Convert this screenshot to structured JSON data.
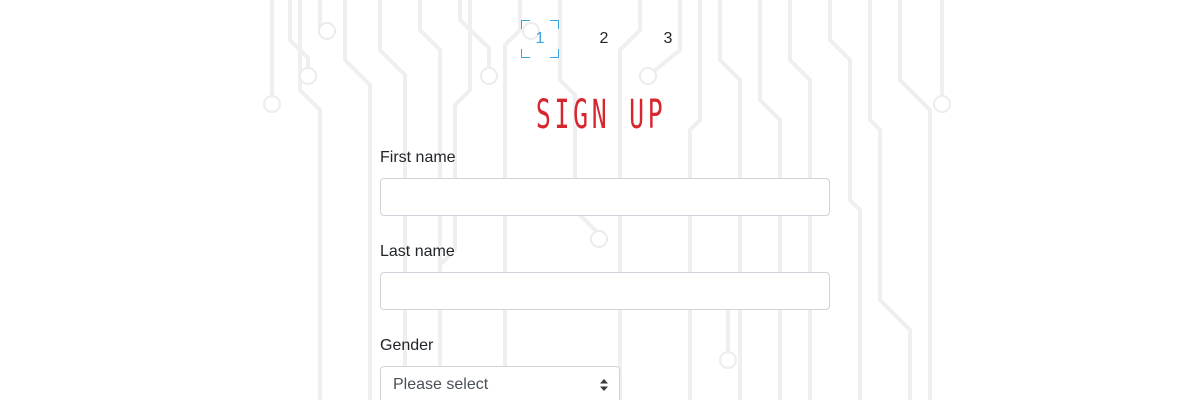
{
  "steps": [
    {
      "label": "1",
      "active": true
    },
    {
      "label": "2",
      "active": false
    },
    {
      "label": "3",
      "active": false
    }
  ],
  "title": "SIGN UP",
  "form": {
    "first_name": {
      "label": "First name",
      "value": "",
      "placeholder": ""
    },
    "last_name": {
      "label": "Last name",
      "value": "",
      "placeholder": ""
    },
    "gender": {
      "label": "Gender",
      "selected": "Please select"
    }
  },
  "colors": {
    "accent": "#3ba6dc",
    "title": "#d7262d",
    "circuit": "#efefef"
  },
  "icons": {
    "select": "select-arrows-icon",
    "background": "circuit-pattern"
  }
}
